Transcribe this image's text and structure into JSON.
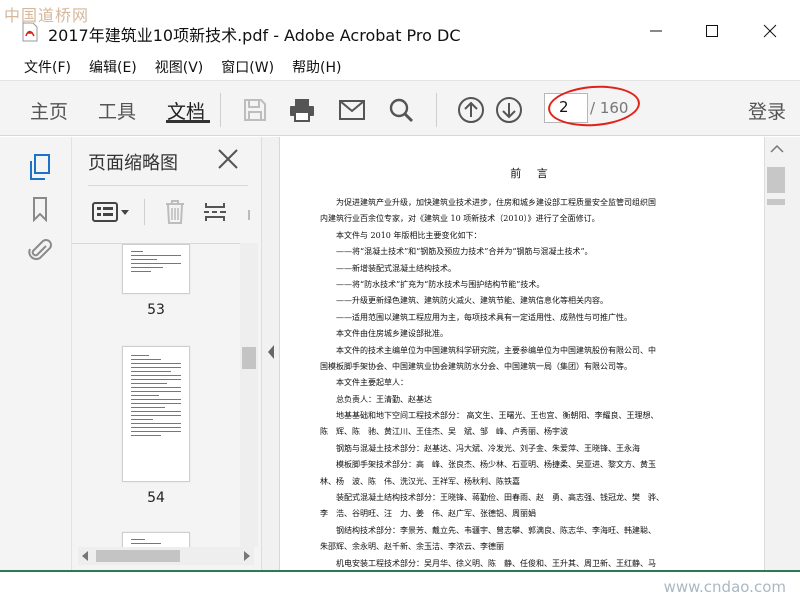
{
  "watermark": {
    "top_left": "中国道桥网",
    "bottom_right": "www.cndao.com"
  },
  "window": {
    "title": "2017年建筑业10项新技术.pdf - Adobe Acrobat Pro DC"
  },
  "menu": [
    "文件(F)",
    "编辑(E)",
    "视图(V)",
    "窗口(W)",
    "帮助(H)"
  ],
  "toolbar": {
    "tabs": [
      "主页",
      "工具",
      "文档"
    ],
    "active_tab": "文档",
    "current_page": "2",
    "total_pages": "/ 160",
    "login": "登录",
    "icons": [
      "save-icon",
      "print-icon",
      "email-icon",
      "search-icon",
      "page-up-icon",
      "page-down-icon"
    ]
  },
  "left_rail": {
    "icons": [
      "page-thumbnails-icon",
      "bookmark-icon",
      "attachment-icon"
    ]
  },
  "thumbnail_panel": {
    "title": "页面缩略图",
    "pages": [
      "53",
      "54"
    ]
  },
  "colors": {
    "toolbar_bg": "#f4f4f4",
    "active_accent": "#1a73c8",
    "annotation_red": "#e0231a",
    "bottom_line": "#2c7a55"
  },
  "document": {
    "heading": "前 言",
    "lines": [
      {
        "indent": 1,
        "text": "为促进建筑产业升级，加快建筑业技术进步，住房和城乡建设部工程质量安全监管司组织国"
      },
      {
        "indent": 0,
        "text": "内建筑行业百余位专家，对《建筑业 10 项新技术（2010）》进行了全面修订。"
      },
      {
        "indent": 1,
        "text": "本文件与 2010 年版相比主要变化如下："
      },
      {
        "indent": 1,
        "text": "——将“混凝土技术”和“钢筋及预应力技术”合并为“钢筋与混凝土技术”。"
      },
      {
        "indent": 1,
        "text": "——新增装配式混凝土结构技术。"
      },
      {
        "indent": 1,
        "text": "——将“防水技术”扩充为“防水技术与围护结构节能”技术。"
      },
      {
        "indent": 1,
        "text": "——升级更新绿色建筑、建筑防火减火、建筑节能、建筑信息化等相关内容。"
      },
      {
        "indent": 1,
        "text": "——适用范围以建筑工程应用为主，每项技术具有一定适用性、成熟性与可推广性。"
      },
      {
        "indent": 1,
        "text": "本文件由住房城乡建设部批准。"
      },
      {
        "indent": 1,
        "text": "本文件的技术主编单位为中国建筑科学研究院，主要参编单位为中国建筑股份有限公司、中"
      },
      {
        "indent": 0,
        "text": "国模板脚手架协会、中国建筑业协会建筑防水分会、中国建筑一局（集团）有限公司等。"
      },
      {
        "indent": 1,
        "text": "本文件主要起草人："
      },
      {
        "indent": 1,
        "text": "总负责人：王清勤、赵基达"
      },
      {
        "indent": 1,
        "text": "地基基础和地下空间工程技术部分： 高文生、王曙光、王也宜、衡朝阳、李耀良、王理想、"
      },
      {
        "indent": 0,
        "text": "陈　辉、陈　驰、黄江川、王佳杰、吴　斌、邹　峰、卢秀丽、杨宇波"
      },
      {
        "indent": 1,
        "text": "钢筋与混凝土技术部分：赵基达、冯大斌、冷发光、刘子金、朱爱萍、王晓锋、王永海"
      },
      {
        "indent": 1,
        "text": "模板脚手架技术部分：高　峰、张良杰、杨少林、石亚明、杨捷柔、吴亚进、黎文方、黄玉"
      },
      {
        "indent": 0,
        "text": "林、杨　波、陈　伟、洗汉光、王祥军、杨秋利、陈铁嘉"
      },
      {
        "indent": 1,
        "text": "装配式混凝土结构技术部分：王晓锋、蒋勤俭、田春雨、赵　勇、高志强、钱冠龙、樊　骅、"
      },
      {
        "indent": 0,
        "text": "李　浩、谷明旺、汪　力、姜　伟、赵广军、张德铝、周丽娟"
      },
      {
        "indent": 1,
        "text": "钢结构技术部分：李景芳、戴立先、韦疆宇、曾志攀、郭满良、陈志华、李海旺、韩建聪、"
      },
      {
        "indent": 0,
        "text": "朱邵辉、余永明、赵千新、余玉洁、李浓云、李德丽"
      },
      {
        "indent": 1,
        "text": "机电安装工程技术部分：吴月华、徐义明、陈　静、任俊和、王升其、周卫新、王红静、马"
      }
    ]
  }
}
